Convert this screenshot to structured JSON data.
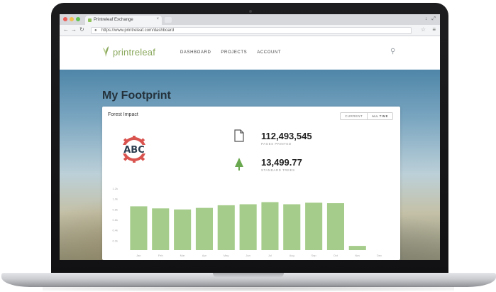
{
  "browser": {
    "tab_title": "Printreleaf Exchange",
    "tab_close": "×",
    "url": "https://www.printreleaf.com/dashboard",
    "window_controls": [
      "↓",
      "⤢"
    ]
  },
  "site": {
    "logo_text": "printreleaf",
    "nav": [
      "DASHBOARD",
      "PROJECTS",
      "ACCOUNT"
    ]
  },
  "page": {
    "title": "My Footprint"
  },
  "card": {
    "title": "Forest Impact",
    "toggle": [
      "CURRENT",
      "ALL TIME"
    ],
    "company_logo_text": "ABC",
    "stats": [
      {
        "icon": "paper-icon",
        "value": "112,493,545",
        "label": "PAGES PRINTED"
      },
      {
        "icon": "tree-icon",
        "value": "13,499.77",
        "label": "STANDARD TREES"
      }
    ]
  },
  "colors": {
    "brand_green": "#8aa85c",
    "bar_green": "#a5cc8a",
    "tree_green": "#6aa84f"
  },
  "chart_data": {
    "type": "bar",
    "categories": [
      "Jan",
      "Feb",
      "Mar",
      "Apr",
      "May",
      "Jun",
      "Jul",
      "Aug",
      "Sep",
      "Oct",
      "Nov",
      "Dec"
    ],
    "values": [
      0.84,
      0.8,
      0.78,
      0.81,
      0.86,
      0.88,
      0.92,
      0.88,
      0.91,
      0.9,
      0.08,
      0
    ],
    "ylim": [
      0,
      1.2
    ],
    "yticks": [
      "1.2k",
      "1.0k",
      "0.8k",
      "0.6k",
      "0.4k",
      "0.2k"
    ],
    "xlabel": "",
    "ylabel": "",
    "grid": false
  }
}
